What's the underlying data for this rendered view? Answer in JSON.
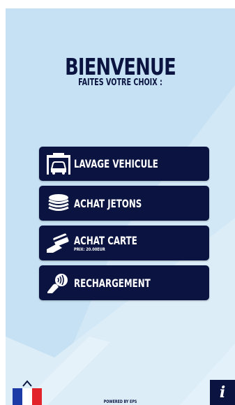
{
  "header": {
    "title": "BIENVENUE",
    "subtitle": "FAITES VOTRE CHOIX :"
  },
  "menu": [
    {
      "label": "LAVAGE VEHICULE",
      "sub": "",
      "icon": "car-wash-icon"
    },
    {
      "label": "ACHAT JETONS",
      "sub": "",
      "icon": "coins-stack-icon"
    },
    {
      "label": "ACHAT CARTE",
      "sub": "PRIX: 20.00EUR",
      "icon": "card-in-hand-icon"
    },
    {
      "label": "RECHARGEMENT",
      "sub": "",
      "icon": "contactless-hand-icon"
    }
  ],
  "footer": {
    "powered_by": "POWERED BY EPS",
    "language": "french-flag-icon",
    "info_icon": "info-icon",
    "info_label": "i"
  },
  "colors": {
    "background": "#c6e1f3",
    "primary": "#0b1440",
    "flag_blue": "#1d3ba6",
    "flag_white": "#ffffff",
    "flag_red": "#e2232a"
  }
}
